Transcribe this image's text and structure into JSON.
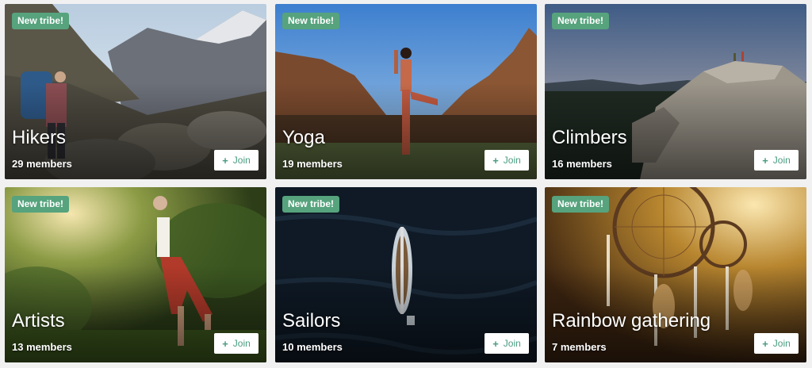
{
  "badge_color": "#56a37d",
  "join_color": "#4a9b82",
  "tribes": [
    {
      "badge": "New tribe!",
      "name": "Hikers",
      "members": "29 members",
      "join_label": "Join",
      "join_icon": "plus-icon"
    },
    {
      "badge": "New tribe!",
      "name": "Yoga",
      "members": "19 members",
      "join_label": "Join",
      "join_icon": "plus-icon"
    },
    {
      "badge": "New tribe!",
      "name": "Climbers",
      "members": "16 members",
      "join_label": "Join",
      "join_icon": "plus-icon"
    },
    {
      "badge": "New tribe!",
      "name": "Artists",
      "members": "13 members",
      "join_label": "Join",
      "join_icon": "plus-icon"
    },
    {
      "badge": "New tribe!",
      "name": "Sailors",
      "members": "10 members",
      "join_label": "Join",
      "join_icon": "plus-icon"
    },
    {
      "badge": "New tribe!",
      "name": "Rainbow gathering",
      "members": "7 members",
      "join_label": "Join",
      "join_icon": "plus-icon"
    }
  ]
}
